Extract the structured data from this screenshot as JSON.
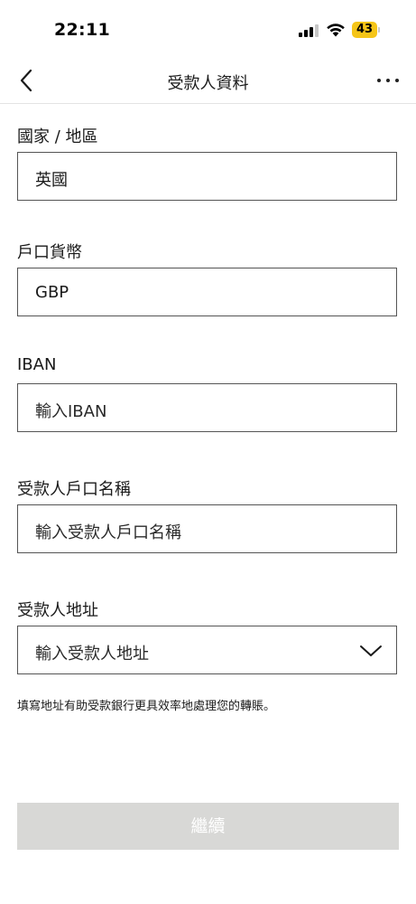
{
  "status_bar": {
    "time": "22:11",
    "battery": "43",
    "battery_color": "#f5c518"
  },
  "header": {
    "title": "受款人資料",
    "back_icon": "chevron-left-icon",
    "more_icon": "more-horizontal-icon"
  },
  "form": {
    "country": {
      "label": "國家 / 地區",
      "value": "英國"
    },
    "currency": {
      "label": "戶口貨幣",
      "value": "GBP"
    },
    "iban": {
      "label": "IBAN",
      "placeholder": "輸入IBAN"
    },
    "account_name": {
      "label": "受款人戶口名稱",
      "placeholder": "輸入受款人戶口名稱"
    },
    "address": {
      "label": "受款人地址",
      "placeholder": "輸入受款人地址",
      "icon": "chevron-down-icon"
    },
    "helper_text": "填寫地址有助受款銀行更具效率地處理您的轉賬。"
  },
  "footer": {
    "continue_label": "繼續",
    "continue_bg": "#d8d8d6"
  }
}
